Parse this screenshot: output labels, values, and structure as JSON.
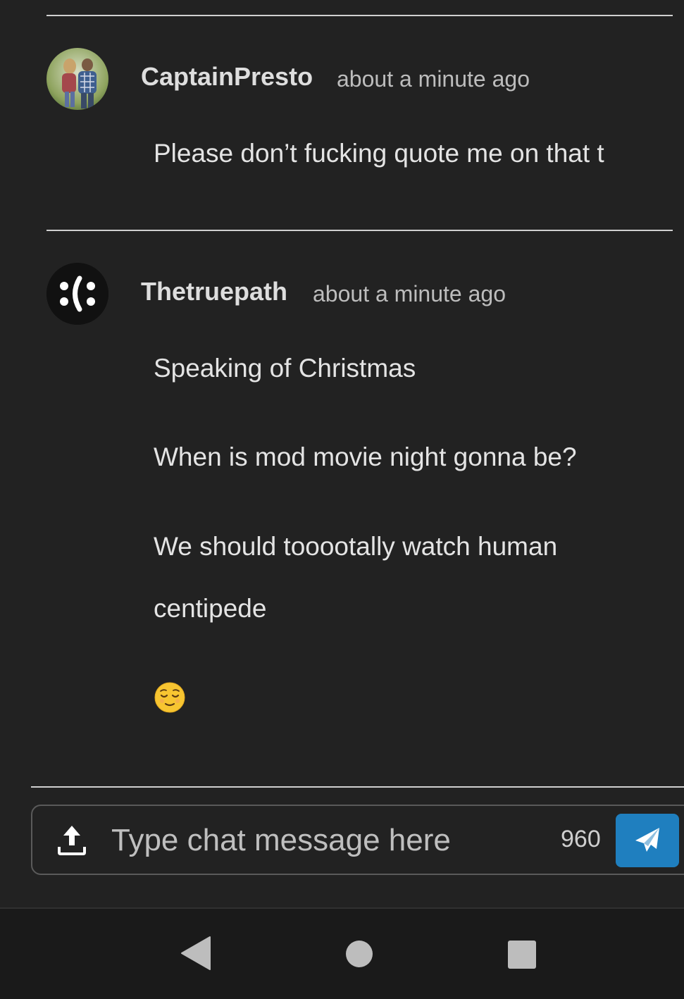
{
  "messages": [
    {
      "username": "CaptainPresto",
      "timestamp": "about a minute ago",
      "lines": [
        "Please don’t fucking quote me on that t"
      ]
    },
    {
      "username": "Thetruepath",
      "timestamp": "about a minute ago",
      "lines": [
        "Speaking of Christmas",
        "When is mod movie night gonna be?",
        "We should tooootally watch human",
        "centipede"
      ],
      "emoji": "relieved-face-emoji"
    }
  ],
  "composer": {
    "placeholder": "Type chat message here",
    "char_count": "960",
    "upload_icon": "upload-icon",
    "send_icon": "paper-plane-icon"
  },
  "nav": {
    "back_icon": "back-triangle-icon",
    "home_icon": "home-circle-icon",
    "recents_icon": "recents-square-icon"
  },
  "colors": {
    "background": "#222222",
    "send_button": "#1f7fbf",
    "divider": "#d0d0d0"
  }
}
